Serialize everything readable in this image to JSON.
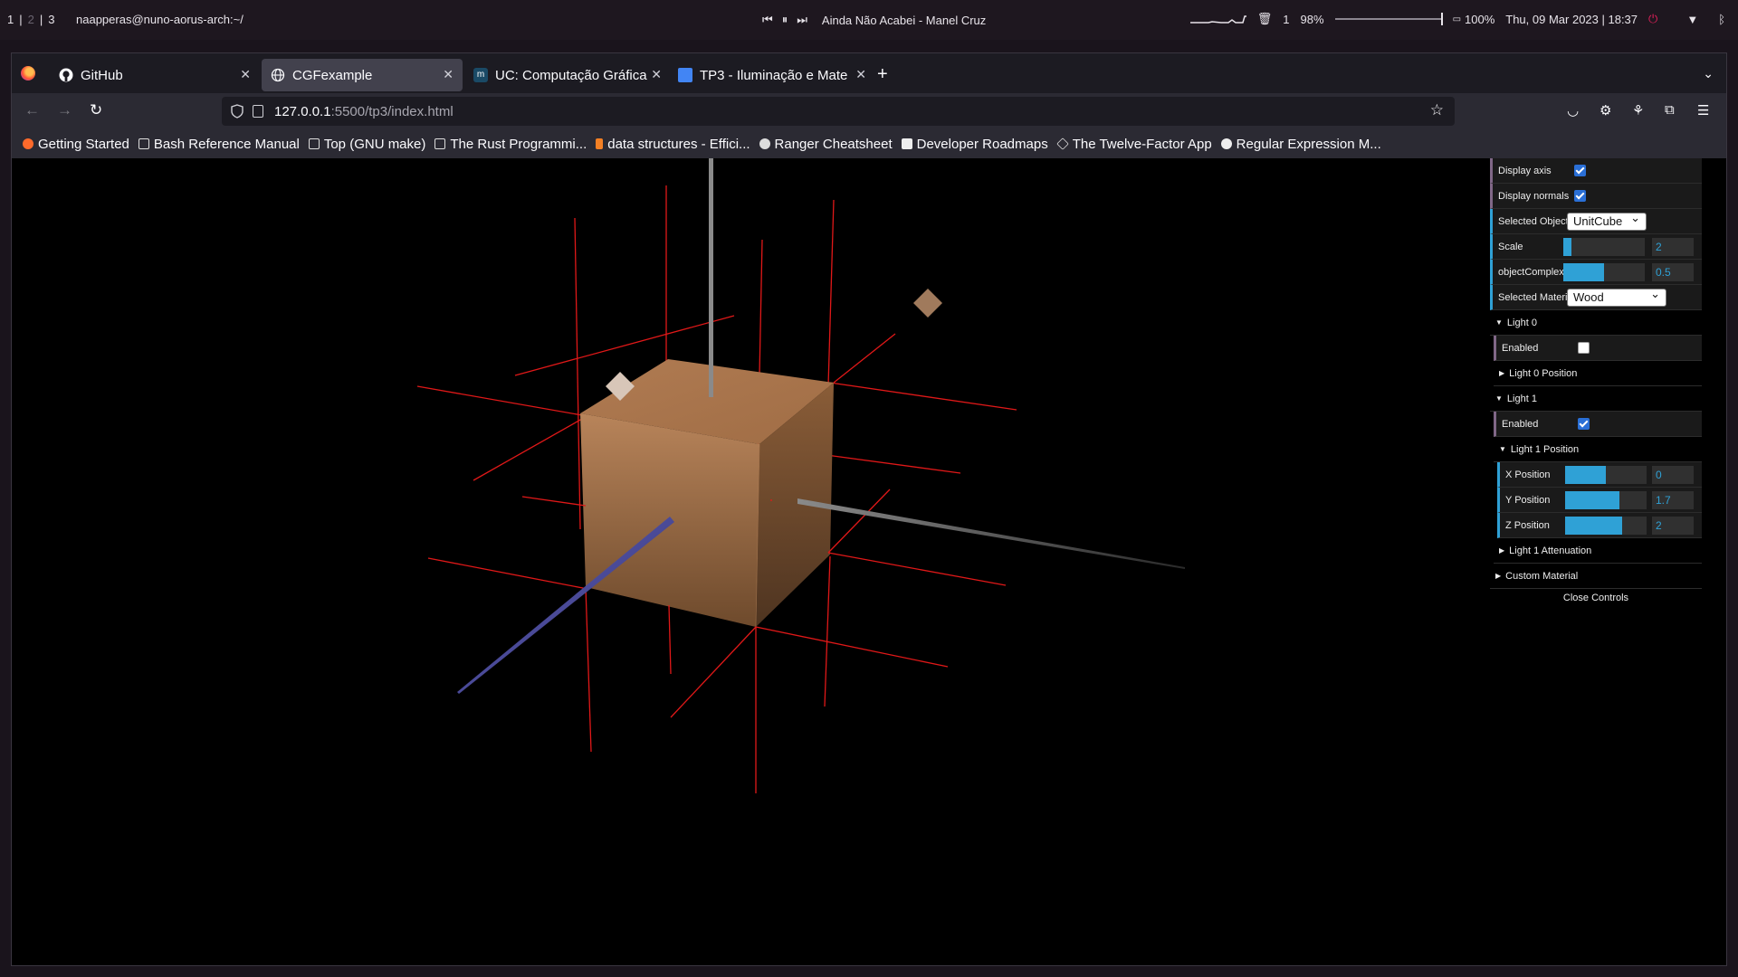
{
  "system_bar": {
    "workspaces": [
      "1",
      "|",
      "2",
      "|",
      "3"
    ],
    "terminal_title": "naapperas@nuno-aorus-arch:~/",
    "media": {
      "prev": "⏮",
      "pause": "⏸",
      "next": "⏭",
      "track": "Ainda Não Acabei - Manel Cruz"
    },
    "trash_count": "1",
    "volume": "98%",
    "volume_level": 0.98,
    "battery": "100%",
    "datetime": "Thu, 09 Mar 2023 | 18:37"
  },
  "tabs": [
    {
      "title": "GitHub",
      "active": false
    },
    {
      "title": "CGFexample",
      "active": true
    },
    {
      "title": "UC: Computação Gráfica",
      "active": false
    },
    {
      "title": "TP3 - Iluminação e Mate",
      "active": false
    }
  ],
  "url": {
    "host": "127.0.0.1",
    "path": ":5500/tp3/index.html"
  },
  "bookmarks": [
    "Getting Started",
    "Bash Reference Manual",
    "Top (GNU make)",
    "The Rust Programmi...",
    "data structures - Effici...",
    "Ranger Cheatsheet",
    "Developer Roadmaps",
    "The Twelve-Factor App",
    "Regular Expression M..."
  ],
  "gui": {
    "display_axis": {
      "label": "Display axis",
      "checked": true
    },
    "display_normals": {
      "label": "Display normals",
      "checked": true
    },
    "selected_object": {
      "label": "Selected Object",
      "value": "UnitCube"
    },
    "scale": {
      "label": "Scale",
      "value": "2",
      "fill": 0.1
    },
    "complexity": {
      "label": "objectComplexity",
      "value": "0.5",
      "fill": 0.5
    },
    "selected_material": {
      "label": "Selected Material",
      "value": "Wood"
    },
    "light0": {
      "title": "Light 0",
      "enabled_label": "Enabled",
      "enabled": false,
      "position_folder": "Light 0 Position"
    },
    "light1": {
      "title": "Light 1",
      "enabled_label": "Enabled",
      "enabled": true,
      "position_folder": "Light 1 Position",
      "x": {
        "label": "X Position",
        "value": "0",
        "fill": 0.5
      },
      "y": {
        "label": "Y Position",
        "value": "1.7",
        "fill": 0.67
      },
      "z": {
        "label": "Z Position",
        "value": "2",
        "fill": 0.7
      },
      "attenuation_folder": "Light 1 Attenuation"
    },
    "custom_material": "Custom Material",
    "close_controls": "Close Controls"
  }
}
